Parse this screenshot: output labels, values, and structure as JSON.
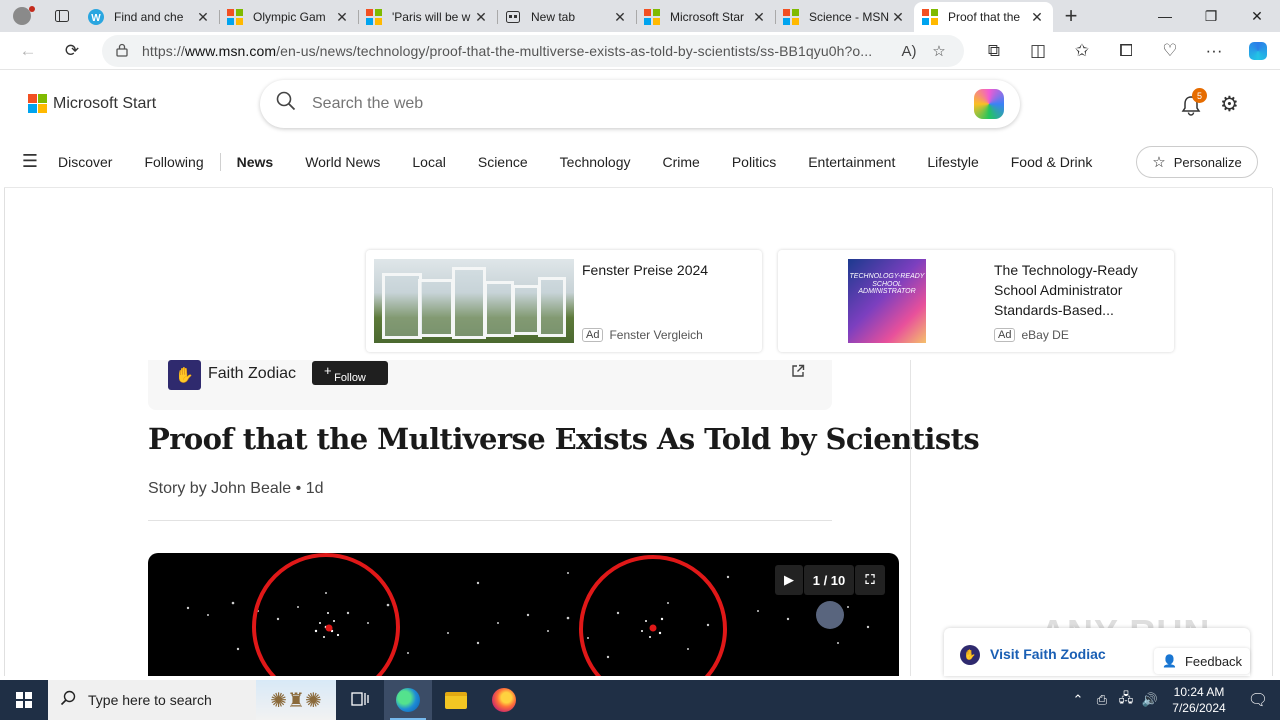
{
  "browser": {
    "tabs": [
      {
        "title": "Find and che",
        "icon": "w-icon"
      },
      {
        "title": "Olympic Gam",
        "icon": "msn-icon"
      },
      {
        "title": "'Paris will be w",
        "icon": "msn-icon"
      },
      {
        "title": "New tab",
        "icon": "newtab-icon"
      },
      {
        "title": "Microsoft Star",
        "icon": "msn-icon"
      },
      {
        "title": "Science - MSN",
        "icon": "msn-icon"
      },
      {
        "title": "Proof that the",
        "icon": "msn-icon",
        "active": true
      }
    ],
    "url_prefix": "https://",
    "url_host": "www.msn.com",
    "url_rest": "/en-us/news/technology/proof-that-the-multiverse-exists-as-told-by-scientists/ss-BB1qyu0h?o..."
  },
  "msn": {
    "logo_text": "Microsoft Start",
    "search_placeholder": "Search the web",
    "notification_count": "5",
    "nav": [
      "Discover",
      "Following",
      "News",
      "World News",
      "Local",
      "Science",
      "Technology",
      "Crime",
      "Politics",
      "Entertainment",
      "Lifestyle",
      "Food & Drink"
    ],
    "personalize_label": "Personalize"
  },
  "ads": [
    {
      "title": "Fenster Preise 2024",
      "badge": "Ad",
      "source": "Fenster Vergleich"
    },
    {
      "title": "The Technology-Ready School Administrator Standards-Based...",
      "badge": "Ad",
      "source": "eBay DE",
      "book_text": "TECHNOLOGY-READY SCHOOL ADMINISTRATOR"
    }
  ],
  "article": {
    "source_name": "Faith Zodiac",
    "follow_label": "Follow",
    "headline": "Proof that the Multiverse Exists As Told by Scientists",
    "byline": "Story by John Beale • 1d",
    "gallery_counter": "1 / 10"
  },
  "visit_label": "Visit Faith Zodiac",
  "feedback_label": "Feedback",
  "watermark": "ANY RUN",
  "taskbar": {
    "search_placeholder": "Type here to search",
    "time": "10:24 AM",
    "date": "7/26/2024"
  },
  "colors": {
    "accent_link": "#1a5fb4",
    "badge_orange": "#e66c00",
    "taskbar": "#1f2f45"
  }
}
